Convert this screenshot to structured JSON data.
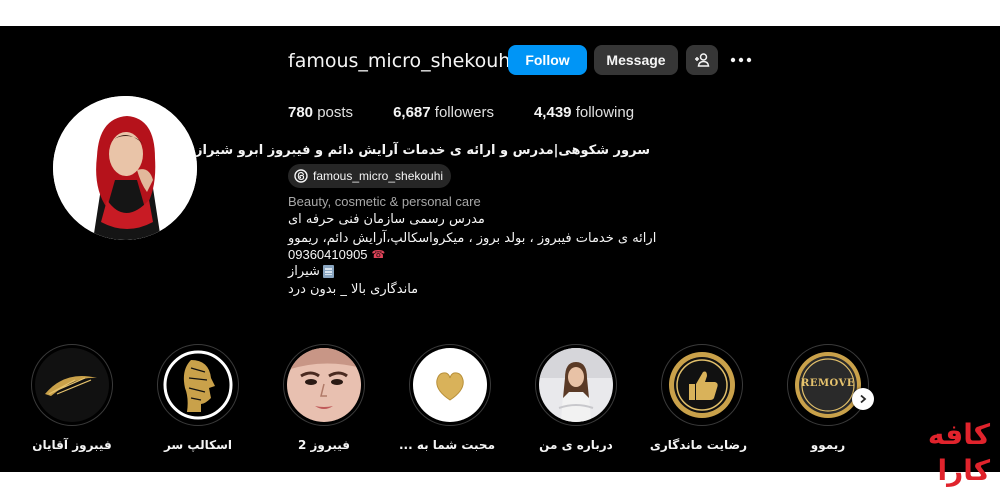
{
  "profile": {
    "username": "famous_micro_shekouhi",
    "follow_label": "Follow",
    "message_label": "Message",
    "posts_count": "780",
    "posts_label": "posts",
    "followers_count": "6,687",
    "followers_label": "followers",
    "following_count": "4,439",
    "following_label": "following",
    "full_name": "سرور شکوهی|مدرس و ارائه ی خدمات آرایش دائم و فیبروز ابرو شیراز",
    "threads_handle": "famous_micro_shekouhi",
    "category": "Beauty, cosmetic & personal care",
    "bio": {
      "line1": "مدرس رسمی سازمان فنی حرفه ای",
      "line2": "ارائه ی خدمات فیبروز ، بولد بروز ، میکرواسکالپ،آرایش دائم، ریموو",
      "phone": "09360410905",
      "city": "شیراز",
      "line5": "ماندگاری بالا _ بدون درد"
    }
  },
  "highlights": [
    {
      "label": "فیبروز آقایان",
      "icon": "golden-brow-icon"
    },
    {
      "label": "اسکالپ سر",
      "icon": "golden-head-profile-icon"
    },
    {
      "label": "فیبروز 2",
      "icon": "face-photo"
    },
    {
      "label": "محبت شما به ...",
      "icon": "gold-heart-icon"
    },
    {
      "label": "درباره ی من",
      "icon": "portrait-photo"
    },
    {
      "label": "رضایت ماندگاری",
      "icon": "gold-thumbs-up-icon"
    },
    {
      "label": "ریموو",
      "icon": "remove-badge-icon"
    }
  ],
  "highlight_badge_text": "REMOVE",
  "watermark": {
    "line1": "کافه",
    "line2": "کارا"
  },
  "colors": {
    "follow": "#0095f6",
    "button_dark": "#363636",
    "background": "#000000",
    "watermark": "#e0232c"
  }
}
